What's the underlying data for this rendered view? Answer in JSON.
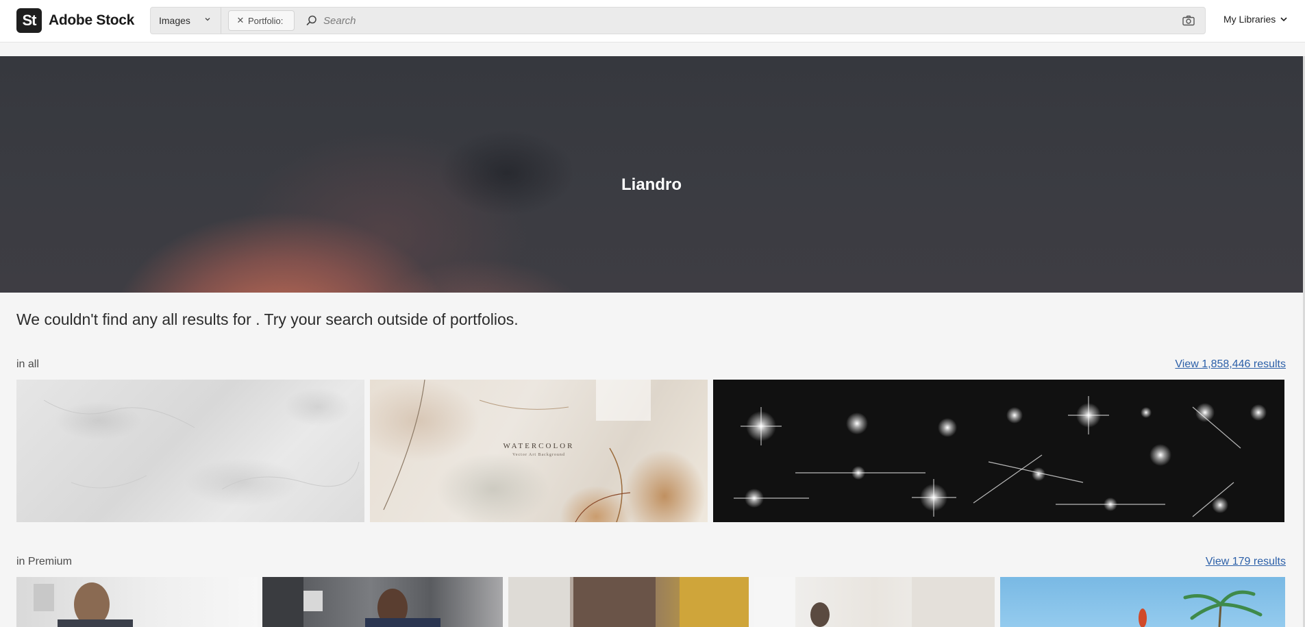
{
  "header": {
    "logo_mark": "St",
    "logo_text": "Adobe Stock",
    "type_select": "Images",
    "chip_label": "Portfolio:",
    "search_placeholder": "Search",
    "libraries_label": "My Libraries"
  },
  "hero": {
    "title": "Liandro"
  },
  "message": "We couldn't find any all results for . Try your search outside of portfolios.",
  "sections": [
    {
      "label": "in all",
      "link": "View 1,858,446 results",
      "thumbnail_text": {
        "title": "WATERCOLOR",
        "subtitle": "Vector Art Background"
      }
    },
    {
      "label": "in Premium",
      "link": "View 179 results"
    }
  ],
  "colors": {
    "link": "#2b5fa8",
    "background": "#f5f5f5",
    "header": "#ffffff",
    "hero": "#3b3c42"
  }
}
